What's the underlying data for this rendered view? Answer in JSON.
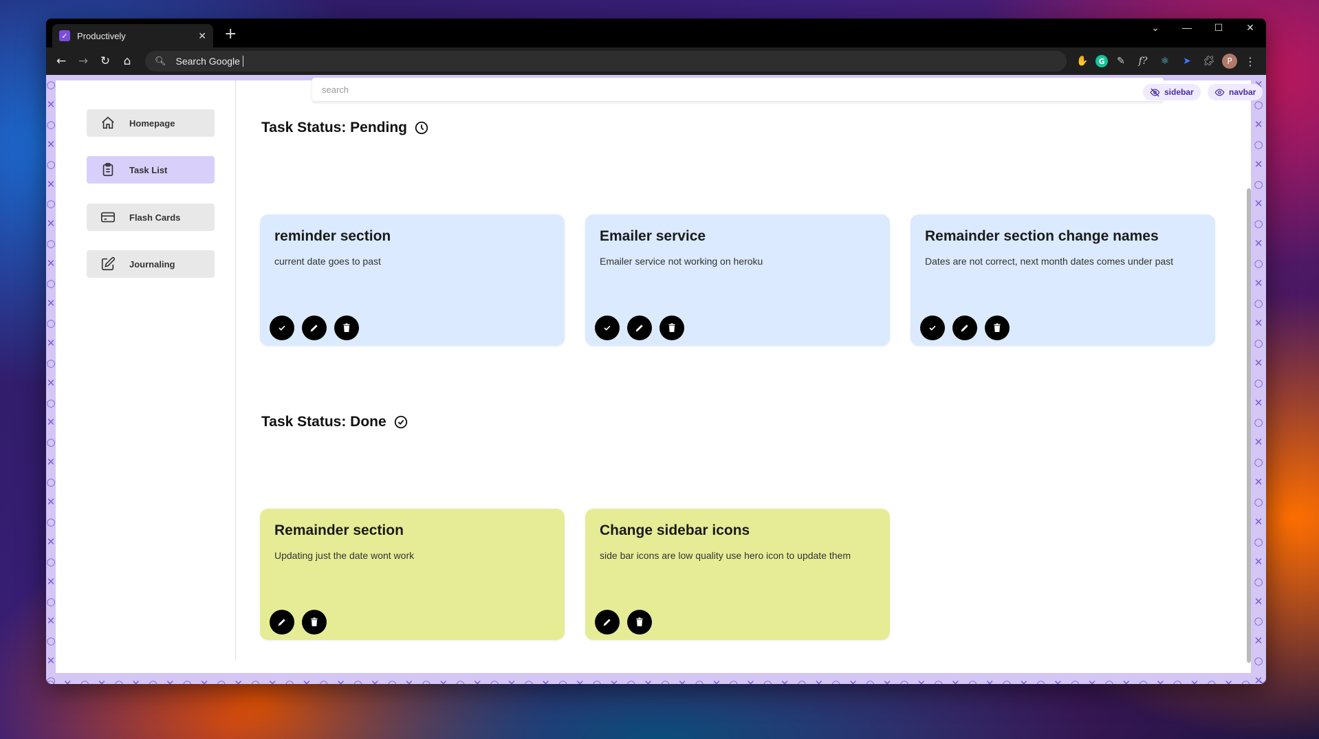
{
  "browser": {
    "tab_title": "Productively",
    "tab_close": "✕",
    "new_tab": "+",
    "omnibox_text": "Search Google",
    "avatar_letter": "P",
    "window_controls": {
      "minimize": "—",
      "maximize": "☐",
      "close": "✕",
      "tabsearch": "⌄"
    }
  },
  "sidebar": {
    "items": [
      {
        "label": "Homepage",
        "icon": "home-icon",
        "active": false
      },
      {
        "label": "Task List",
        "icon": "clipboard-icon",
        "active": true
      },
      {
        "label": "Flash Cards",
        "icon": "credit-card-icon",
        "active": false
      },
      {
        "label": "Journaling",
        "icon": "pencil-square-icon",
        "active": false
      }
    ]
  },
  "search": {
    "placeholder": "search"
  },
  "toggles": {
    "sidebar": "sidebar",
    "navbar": "navbar"
  },
  "sections": {
    "pending": {
      "title": "Task Status: Pending",
      "cards": [
        {
          "title": "reminder section",
          "desc": "current date goes to past"
        },
        {
          "title": "Emailer service",
          "desc": "Emailer service not working on heroku"
        },
        {
          "title": "Remainder section change names",
          "desc": "Dates are not correct, next month dates comes under past"
        }
      ]
    },
    "done": {
      "title": "Task Status: Done",
      "cards": [
        {
          "title": "Remainder section",
          "desc": "Updating just the date wont work"
        },
        {
          "title": "Change sidebar icons",
          "desc": "side bar icons are low quality use hero icon to update them"
        }
      ]
    }
  },
  "colors": {
    "accent": "#d8cffb",
    "pending_card": "#dbeafe",
    "done_card": "#e6ec96",
    "pattern": "#7b5ed6"
  }
}
